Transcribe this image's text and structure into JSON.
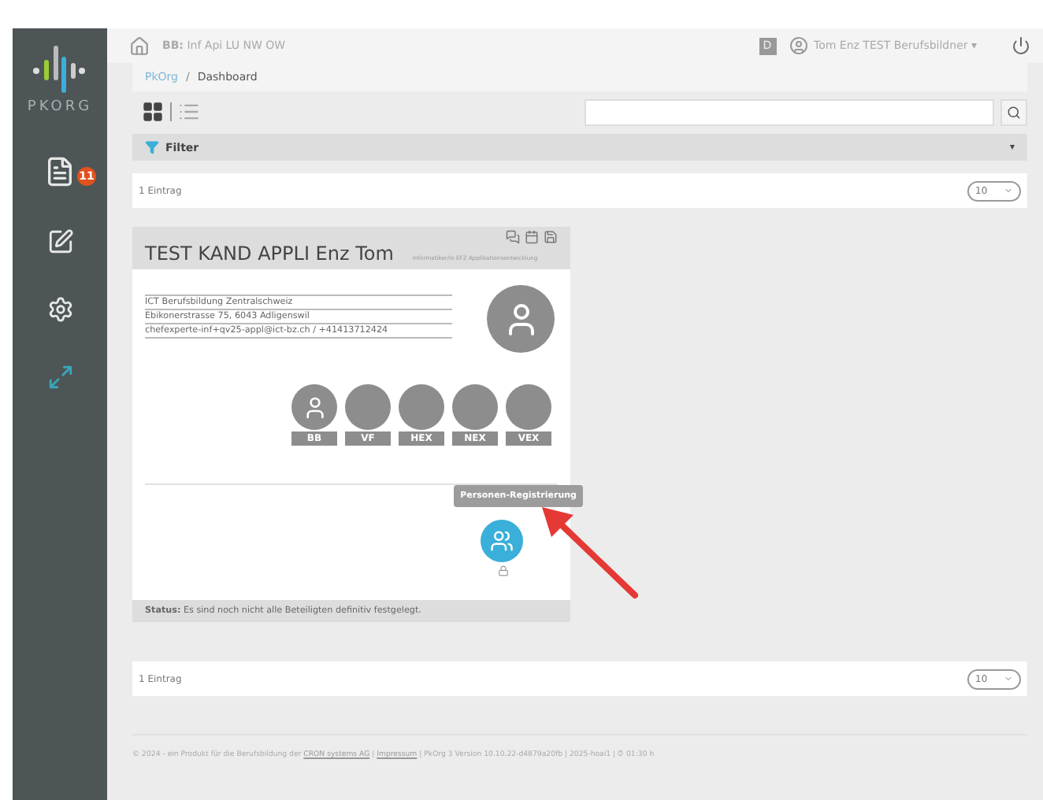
{
  "header": {
    "context_label": "BB:",
    "context": "Inf Api LU NW OW",
    "badge": "D",
    "user": "Tom Enz TEST Berufsbildner",
    "caret": "▾"
  },
  "sidebar": {
    "logo": "PKORG",
    "notification_count": "11"
  },
  "breadcrumb": {
    "items": [
      "PkOrg",
      "Dashboard"
    ],
    "separator": "/"
  },
  "view_toggle": [
    {
      "kind": "grid",
      "selected": true
    },
    {
      "kind": "list",
      "selected": false
    }
  ],
  "filter": {
    "label": "Filter",
    "caret": "▾"
  },
  "pager_top": {
    "count": "1 Eintrag",
    "page_size": "10"
  },
  "card": {
    "title": "TEST KAND APPLI Enz Tom",
    "subtitle": "Informatiker/in EFZ Applikationsentwicklung",
    "address_lines": [
      "ICT Berufsbildung Zentralschweiz",
      "Ebikonerstrasse 75, 6043 Adligenswil",
      "chefexperte-inf+qv25-appl@ict-bz.ch / +41413712424"
    ],
    "roles": [
      {
        "label": "BB",
        "assigned": true
      },
      {
        "label": "VF",
        "assigned": false
      },
      {
        "label": "HEX",
        "assigned": false
      },
      {
        "label": "NEX",
        "assigned": false
      },
      {
        "label": "VEX",
        "assigned": false
      }
    ],
    "tooltip": "Personen-Registrierung",
    "status_label": "Status:",
    "status_text": "Es sind noch nicht alle Beteiligten definitiv festgelegt."
  },
  "pager_bottom": {
    "count": "1 Eintrag",
    "page_size": "10"
  },
  "footer": [
    {
      "kind": "text",
      "text": "© 2024 - ein Produkt für die Berufsbildung der "
    },
    {
      "kind": "link",
      "text": "CRON systems AG"
    },
    {
      "kind": "text",
      "text": " | "
    },
    {
      "kind": "link",
      "text": "Impressum"
    },
    {
      "kind": "text",
      "text": " | PkOrg 3 Version 10.10.22-d4879a20fb | 2025-hoai1 | ⏱ 01:30 h"
    }
  ]
}
